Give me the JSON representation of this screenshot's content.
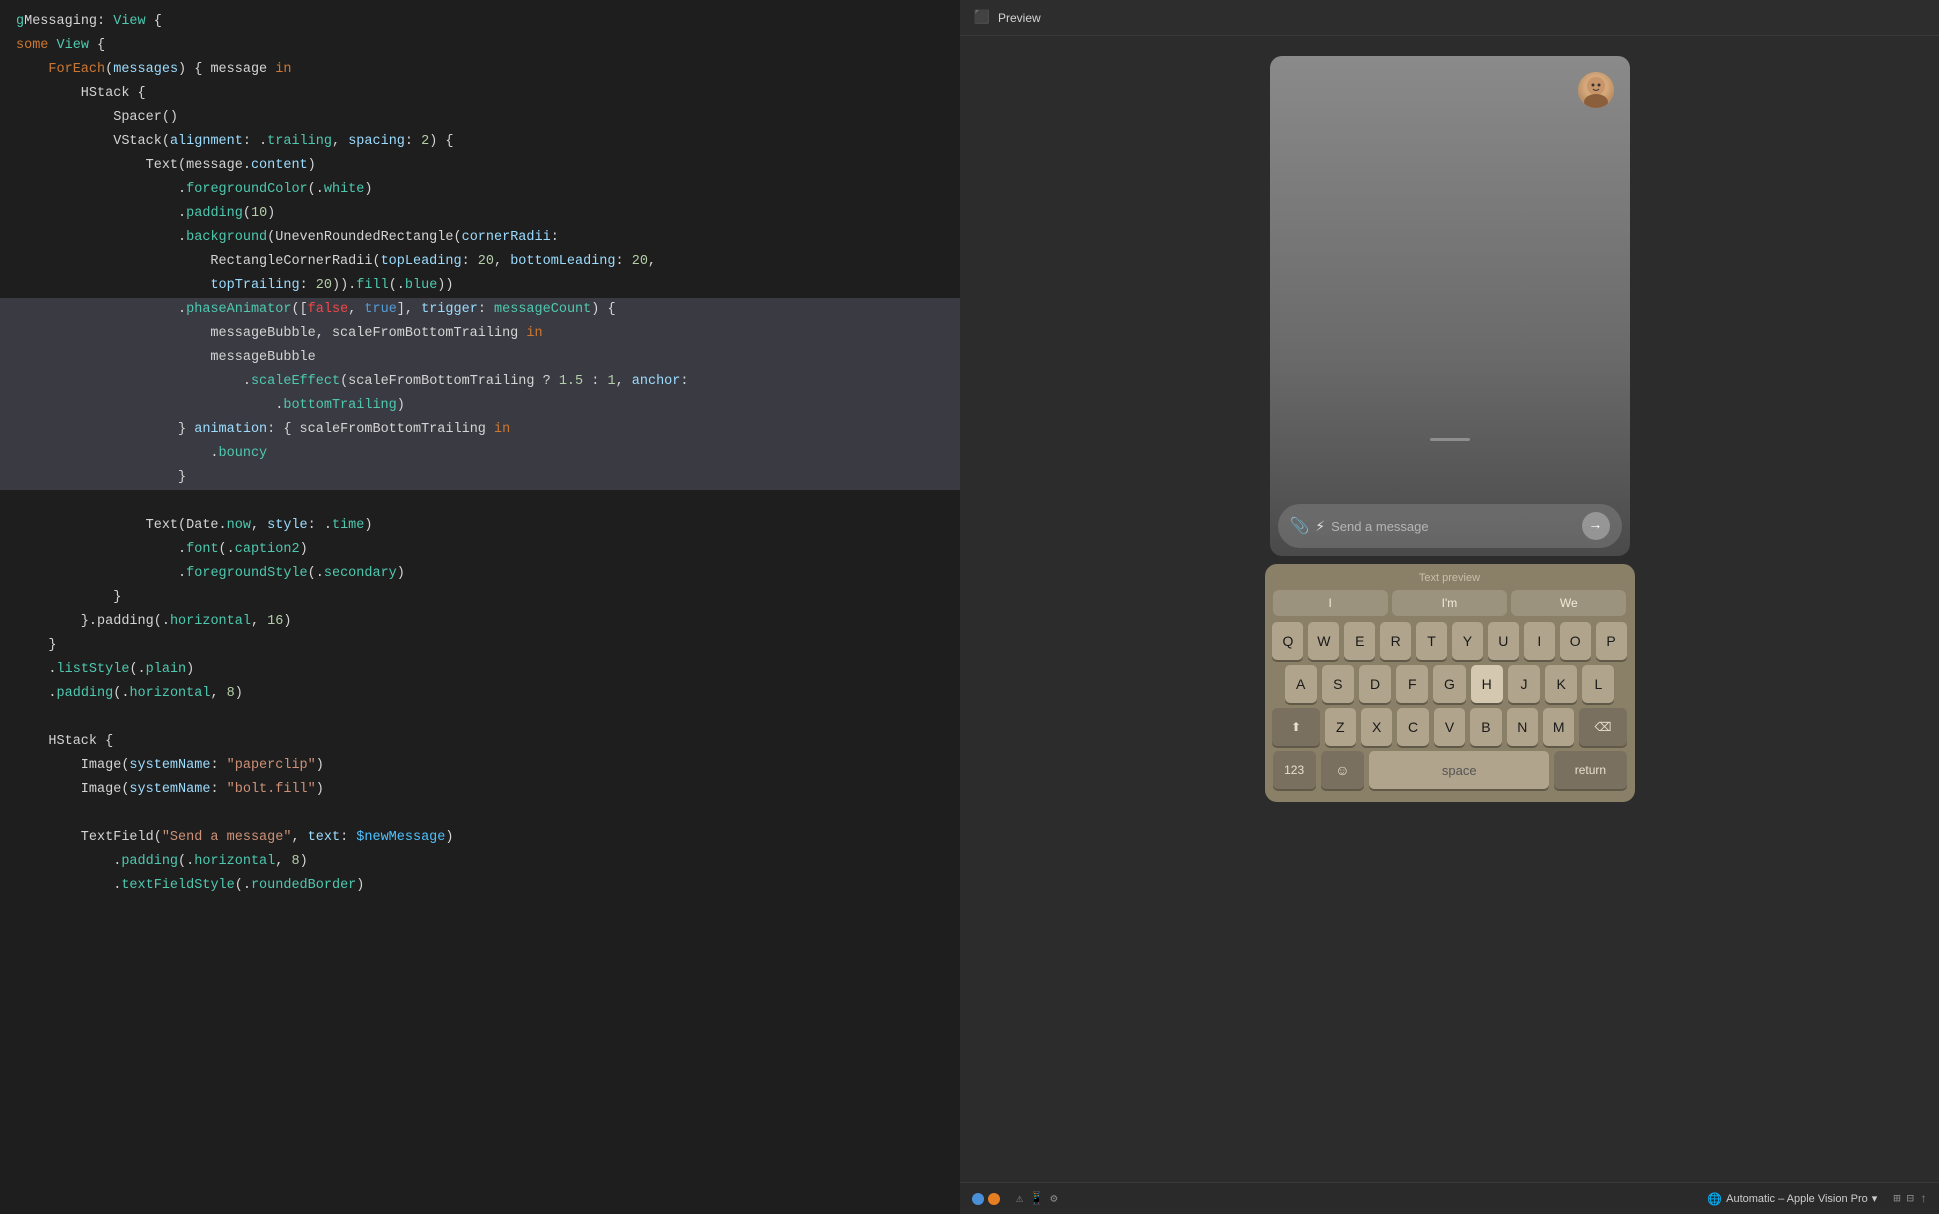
{
  "preview": {
    "header_label": "Preview",
    "header_icon": "▶"
  },
  "messages_app": {
    "input_placeholder": "Send a message",
    "send_icon": "→"
  },
  "keyboard": {
    "preview_label": "Text preview",
    "suggestions": [
      "I",
      "I'm",
      "We"
    ],
    "rows": [
      [
        "Q",
        "W",
        "E",
        "R",
        "T",
        "Y",
        "U",
        "I",
        "O",
        "P"
      ],
      [
        "A",
        "S",
        "D",
        "F",
        "G",
        "H",
        "J",
        "K",
        "L"
      ],
      [
        "↑",
        "Z",
        "X",
        "C",
        "V",
        "B",
        "N",
        "M",
        "⌫"
      ],
      [
        "123",
        "☺",
        "space",
        "return"
      ]
    ],
    "space_label": "space",
    "return_label": "return"
  },
  "status_bar": {
    "device_label": "Automatic – Apple Vision Pro",
    "device_icon": "🌐"
  },
  "code": {
    "lines": [
      {
        "text": "gMessaging: View {",
        "indent": 0
      },
      {
        "text": "some View {",
        "indent": 0
      },
      {
        "text": "    ForEach(messages) { message in",
        "indent": 1
      },
      {
        "text": "        HStack {",
        "indent": 2
      },
      {
        "text": "            Spacer()",
        "indent": 3
      },
      {
        "text": "            VStack(alignment: .trailing, spacing: 2) {",
        "indent": 3
      },
      {
        "text": "                Text(message.content)",
        "indent": 4
      },
      {
        "text": "                    .foregroundColor(.white)",
        "indent": 5
      },
      {
        "text": "                    .padding(10)",
        "indent": 5
      },
      {
        "text": "                    .background(UnevenRoundedRectangle(cornerRadii:",
        "indent": 5
      },
      {
        "text": "                        RectangleCornerRadii(topLeading: 20, bottomLeading: 20,",
        "indent": 6
      },
      {
        "text": "                        topTrailing: 20)).fill(.blue))",
        "indent": 6
      },
      {
        "text": "                    .phaseAnimator([false, true], trigger: messageCount) {",
        "indent": 5,
        "highlight": true
      },
      {
        "text": "                        messageBubble, scaleFromBottomTrailing in",
        "indent": 6,
        "highlight": true
      },
      {
        "text": "                        messageBubble",
        "indent": 6,
        "highlight": true
      },
      {
        "text": "                            .scaleEffect(scaleFromBottomTrailing ? 1.5 : 1, anchor:",
        "indent": 7,
        "highlight": true
      },
      {
        "text": "                                .bottomTrailing)",
        "indent": 8,
        "highlight": true
      },
      {
        "text": "                    } animation: { scaleFromBottomTrailing in",
        "indent": 5,
        "highlight": true
      },
      {
        "text": "                        .bouncy",
        "indent": 6,
        "highlight": true
      },
      {
        "text": "                    }",
        "indent": 5,
        "highlight": true
      },
      {
        "text": "",
        "indent": 0
      },
      {
        "text": "                Text(Date.now, style: .time)",
        "indent": 4
      },
      {
        "text": "                    .font(.caption2)",
        "indent": 5
      },
      {
        "text": "                    .foregroundStyle(.secondary)",
        "indent": 5
      },
      {
        "text": "            }",
        "indent": 3
      },
      {
        "text": "        }.padding(.horizontal, 16)",
        "indent": 2
      },
      {
        "text": "    }",
        "indent": 1
      },
      {
        "text": "    .listStyle(.plain)",
        "indent": 1
      },
      {
        "text": "    .padding(.horizontal, 8)",
        "indent": 1
      },
      {
        "text": "",
        "indent": 0
      },
      {
        "text": "    HStack {",
        "indent": 1
      },
      {
        "text": "        Image(systemName: \"paperclip\")",
        "indent": 2
      },
      {
        "text": "        Image(systemName: \"bolt.fill\")",
        "indent": 2
      },
      {
        "text": "",
        "indent": 0
      },
      {
        "text": "        TextField(\"Send a message\", text: $newMessage)",
        "indent": 2
      },
      {
        "text": "            .padding(.horizontal, 8)",
        "indent": 3
      },
      {
        "text": "            .textFieldStyle(.roundedBorder)",
        "indent": 3
      }
    ]
  }
}
